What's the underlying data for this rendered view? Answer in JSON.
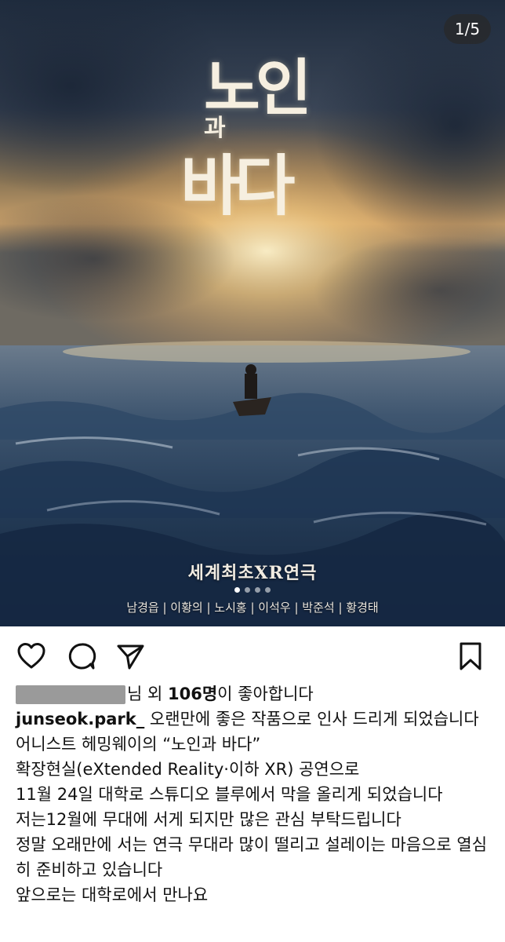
{
  "post": {
    "image_counter": "1/5",
    "poster": {
      "title_line1": "노인",
      "title_line2": "과",
      "title_line3": "바다",
      "subtitle": "세계최초XR연극",
      "cast": "남경읍 | 이황의 | 노시홍 | 이석우 | 박준석 | 황경태"
    },
    "carousel": {
      "count": 4,
      "active_index": 0
    }
  },
  "actions": {
    "like_icon": "heart-icon",
    "comment_icon": "comment-icon",
    "share_icon": "send-icon",
    "save_icon": "bookmark-icon"
  },
  "likes": {
    "suffix_before": "님 외 ",
    "count": "106명",
    "suffix_after": "이 좋아합니다"
  },
  "caption": {
    "username": "junseok.park_",
    "first_line": " 오랜만에 좋은 작품으로 인사 드리게 되었습니다",
    "lines": [
      "어니스트 헤밍웨이의 “노인과 바다”",
      "확장현실(eXtended Reality·이하 XR) 공연으로",
      "11월 24일 대학로 스튜디오 블루에서 막을 올리게 되었습니다",
      "저는12월에 무대에 서게 되지만 많은 관심 부탁드립니다",
      "정말 오래만에 서는 연극 무대라 많이 떨리고 설레이는 마음으로 열심히 준비하고 있습니다",
      "앞으로는 대학로에서 만나요"
    ]
  }
}
